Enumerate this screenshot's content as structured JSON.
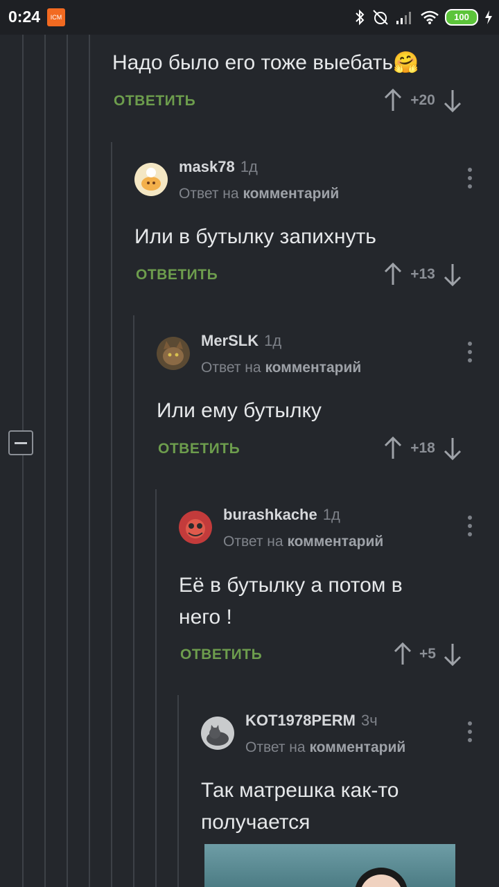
{
  "status_bar": {
    "time": "0:24",
    "app_icon_label": "ICM",
    "battery": "100"
  },
  "comments": [
    {
      "text": "Надо было его тоже выебать🤗",
      "reply_label": "ОТВЕТИТЬ",
      "score": "+20"
    },
    {
      "user": "mask78",
      "time": "1д",
      "reply_prefix": "Ответ на",
      "reply_target": "комментарий",
      "text": "Или в бутылку запихнуть",
      "reply_label": "ОТВЕТИТЬ",
      "score": "+13"
    },
    {
      "user": "MerSLK",
      "time": "1д",
      "reply_prefix": "Ответ на",
      "reply_target": "комментарий",
      "text": "Или ему бутылку",
      "reply_label": "ОТВЕТИТЬ",
      "score": "+18"
    },
    {
      "user": "burashkache",
      "time": "1д",
      "reply_prefix": "Ответ на",
      "reply_target": "комментарий",
      "text_line1": "Её в бутылку а потом в",
      "text_line2": "него !",
      "reply_label": "ОТВЕТИТЬ",
      "score": "+5"
    },
    {
      "user": "KOT1978PERM",
      "time": "3ч",
      "reply_prefix": "Ответ на",
      "reply_target": "комментарий",
      "text_line1": "Так матрешка как-то",
      "text_line2": "получается"
    }
  ],
  "colors": {
    "background": "#24272c",
    "reply_green": "#6d9d4d",
    "muted": "#8b8f96"
  }
}
